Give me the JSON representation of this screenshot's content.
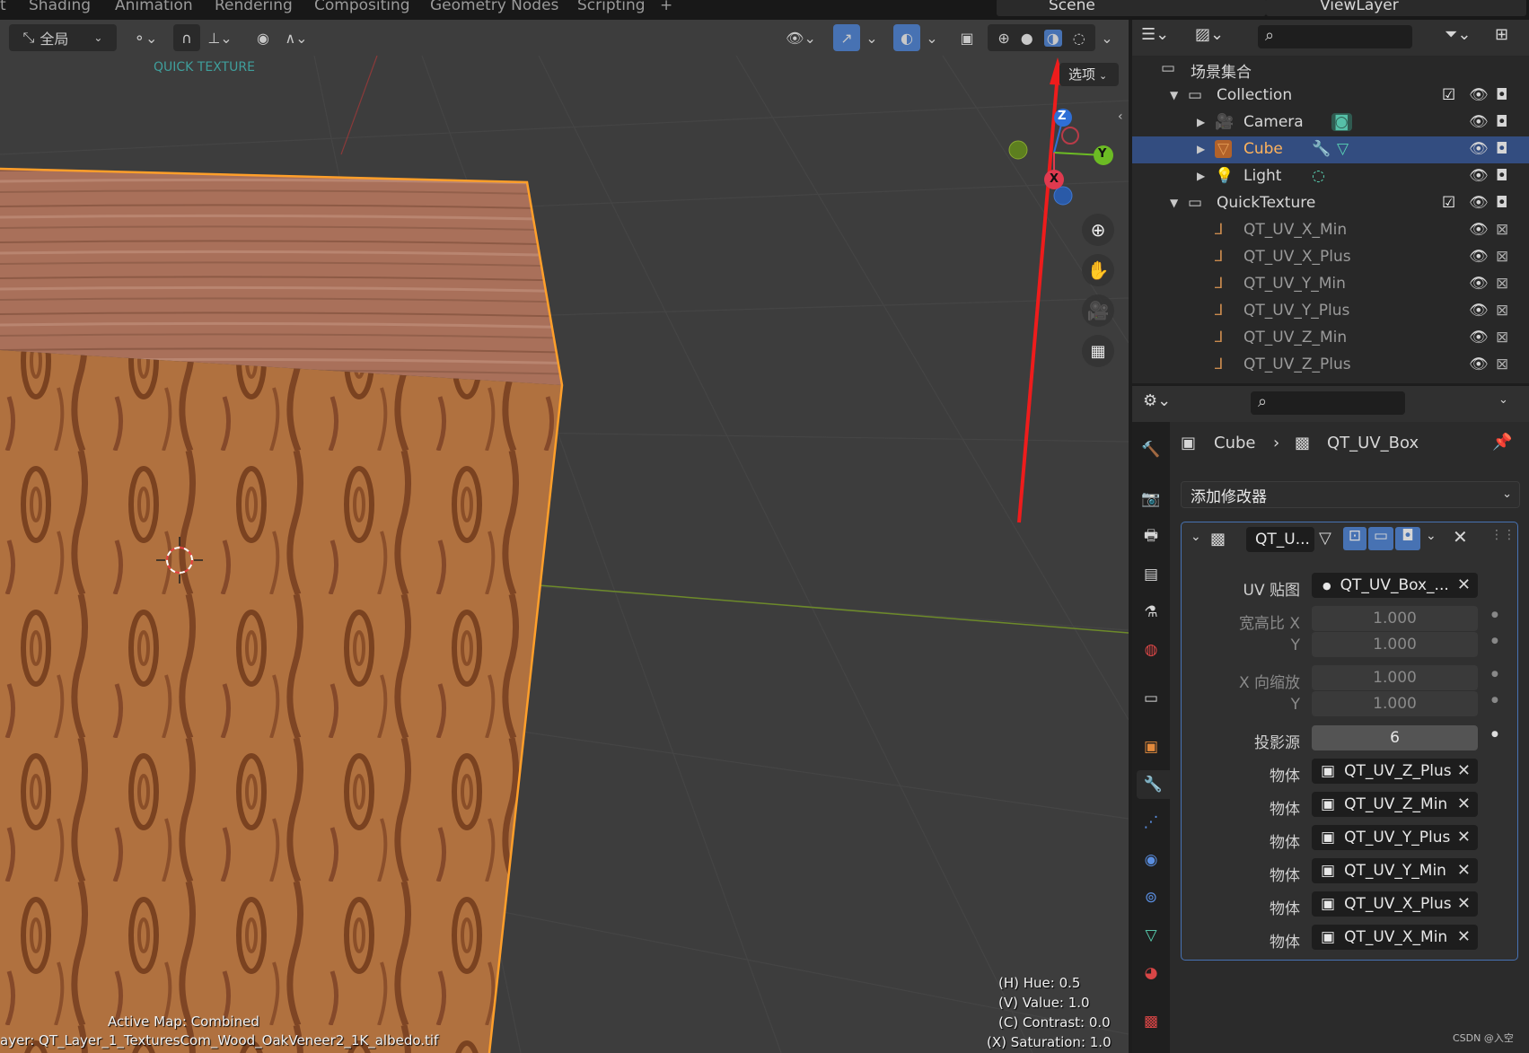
{
  "topbar": {
    "tabs": [
      "t",
      "Shading",
      "Animation",
      "Rendering",
      "Compositing",
      "Geometry Nodes",
      "Scripting",
      "+"
    ],
    "scene": "Scene",
    "view_layer": "ViewLayer"
  },
  "viewport": {
    "transform_orientation": "全局",
    "addon_label": "QUICK TEXTURE",
    "options_label": "选项",
    "axes": {
      "x": "X",
      "y": "Y",
      "z": "Z"
    },
    "active_map": "Active Map: Combined",
    "layer_info": "ayer: QT_Layer_1_TexturesCom_Wood_OakVeneer2_1K_albedo.tif",
    "hsv": {
      "hue": "(H) Hue: 0.5",
      "value": "(V) Value: 1.0",
      "contrast": "(C) Contrast: 0.0",
      "saturation": "(X) Saturation: 1.0"
    }
  },
  "outliner": {
    "root": "场景集合",
    "items": [
      {
        "label": "Collection",
        "type": "collection"
      },
      {
        "label": "Camera",
        "type": "camera"
      },
      {
        "label": "Cube",
        "type": "mesh",
        "selected": true
      },
      {
        "label": "Light",
        "type": "light"
      },
      {
        "label": "QuickTexture",
        "type": "collection"
      },
      {
        "label": "QT_UV_X_Min",
        "type": "empty"
      },
      {
        "label": "QT_UV_X_Plus",
        "type": "empty"
      },
      {
        "label": "QT_UV_Y_Min",
        "type": "empty"
      },
      {
        "label": "QT_UV_Y_Plus",
        "type": "empty"
      },
      {
        "label": "QT_UV_Z_Min",
        "type": "empty"
      },
      {
        "label": "QT_UV_Z_Plus",
        "type": "empty"
      }
    ]
  },
  "properties": {
    "breadcrumb_object": "Cube",
    "breadcrumb_modifier": "QT_UV_Box",
    "add_modifier": "添加修改器",
    "modifier_name": "QT_U...",
    "uv_map_label": "UV 贴图",
    "uv_map_value": "QT_UV_Box_...",
    "aspect_x_label": "宽高比 X",
    "aspect_x": "1.000",
    "aspect_y_label": "Y",
    "aspect_y": "1.000",
    "scale_x_label": "X 向缩放",
    "scale_x": "1.000",
    "scale_y_label": "Y",
    "scale_y": "1.000",
    "projectors_label": "投影源",
    "projectors": "6",
    "object_label": "物体",
    "objects": [
      "QT_UV_Z_Plus",
      "QT_UV_Z_Min",
      "QT_UV_Y_Plus",
      "QT_UV_Y_Min",
      "QT_UV_X_Plus",
      "QT_UV_X_Min"
    ]
  },
  "watermark": "CSDN @入空",
  "colors": {
    "accent": "#4772b3",
    "selected_row": "#334d80",
    "wood": "#a5683e",
    "highlight": "#ff9f2a"
  }
}
